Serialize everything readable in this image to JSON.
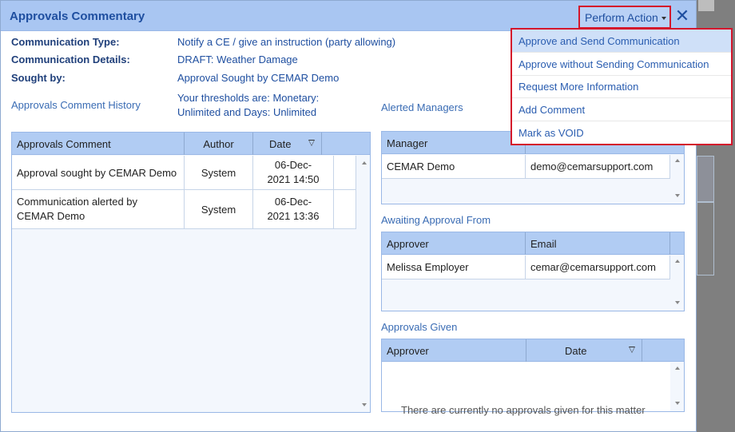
{
  "dialog": {
    "title": "Approvals Commentary",
    "perform_action_label": "Perform Action",
    "close_label": "✕"
  },
  "info": {
    "communication_type_label": "Communication Type:",
    "communication_type_value": "Notify a CE / give an instruction (party allowing)",
    "communication_details_label": "Communication Details:",
    "communication_details_value": "DRAFT: Weather Damage",
    "sought_by_label": "Sought by:",
    "sought_by_value": "Approval Sought by CEMAR Demo",
    "history_label": "Approvals Comment History",
    "thresholds_line1": "Your thresholds are: Monetary:",
    "thresholds_line2": "Unlimited and Days: Unlimited"
  },
  "comment_grid": {
    "headers": [
      "Approvals Comment",
      "Author",
      "Date"
    ],
    "rows": [
      {
        "comment": "Approval sought by CEMAR Demo",
        "author": "System",
        "date_line1": "06-Dec-",
        "date_line2": "2021 14:50"
      },
      {
        "comment_line1": "Communication alerted by",
        "comment_line2": "CEMAR Demo",
        "author": "System",
        "date_line1": "06-Dec-",
        "date_line2": "2021 13:36"
      }
    ]
  },
  "alerted_managers": {
    "title": "Alerted Managers",
    "headers": [
      "Manager",
      ""
    ],
    "rows": [
      {
        "name": "CEMAR Demo",
        "email": "demo@cemarsupport.com"
      }
    ]
  },
  "awaiting_approval": {
    "title": "Awaiting Approval From",
    "headers": [
      "Approver",
      "Email"
    ],
    "rows": [
      {
        "name": "Melissa Employer",
        "email": "cemar@cemarsupport.com"
      }
    ]
  },
  "approvals_given": {
    "title": "Approvals Given",
    "headers": [
      "Approver",
      "Date"
    ],
    "empty_message": "There are currently no approvals given for this matter"
  },
  "menu": {
    "items": [
      {
        "label": "Approve and Send Communication",
        "active": true
      },
      {
        "label": "Approve without Sending Communication"
      },
      {
        "label": "Request More Information"
      },
      {
        "label": "Add Comment"
      },
      {
        "label": "Mark as VOID"
      }
    ]
  },
  "colors": {
    "header_bg": "#a9c6f2",
    "accent": "#1f4fa0",
    "highlight_border": "#d4162b",
    "grid_header": "#b1ccf3"
  }
}
